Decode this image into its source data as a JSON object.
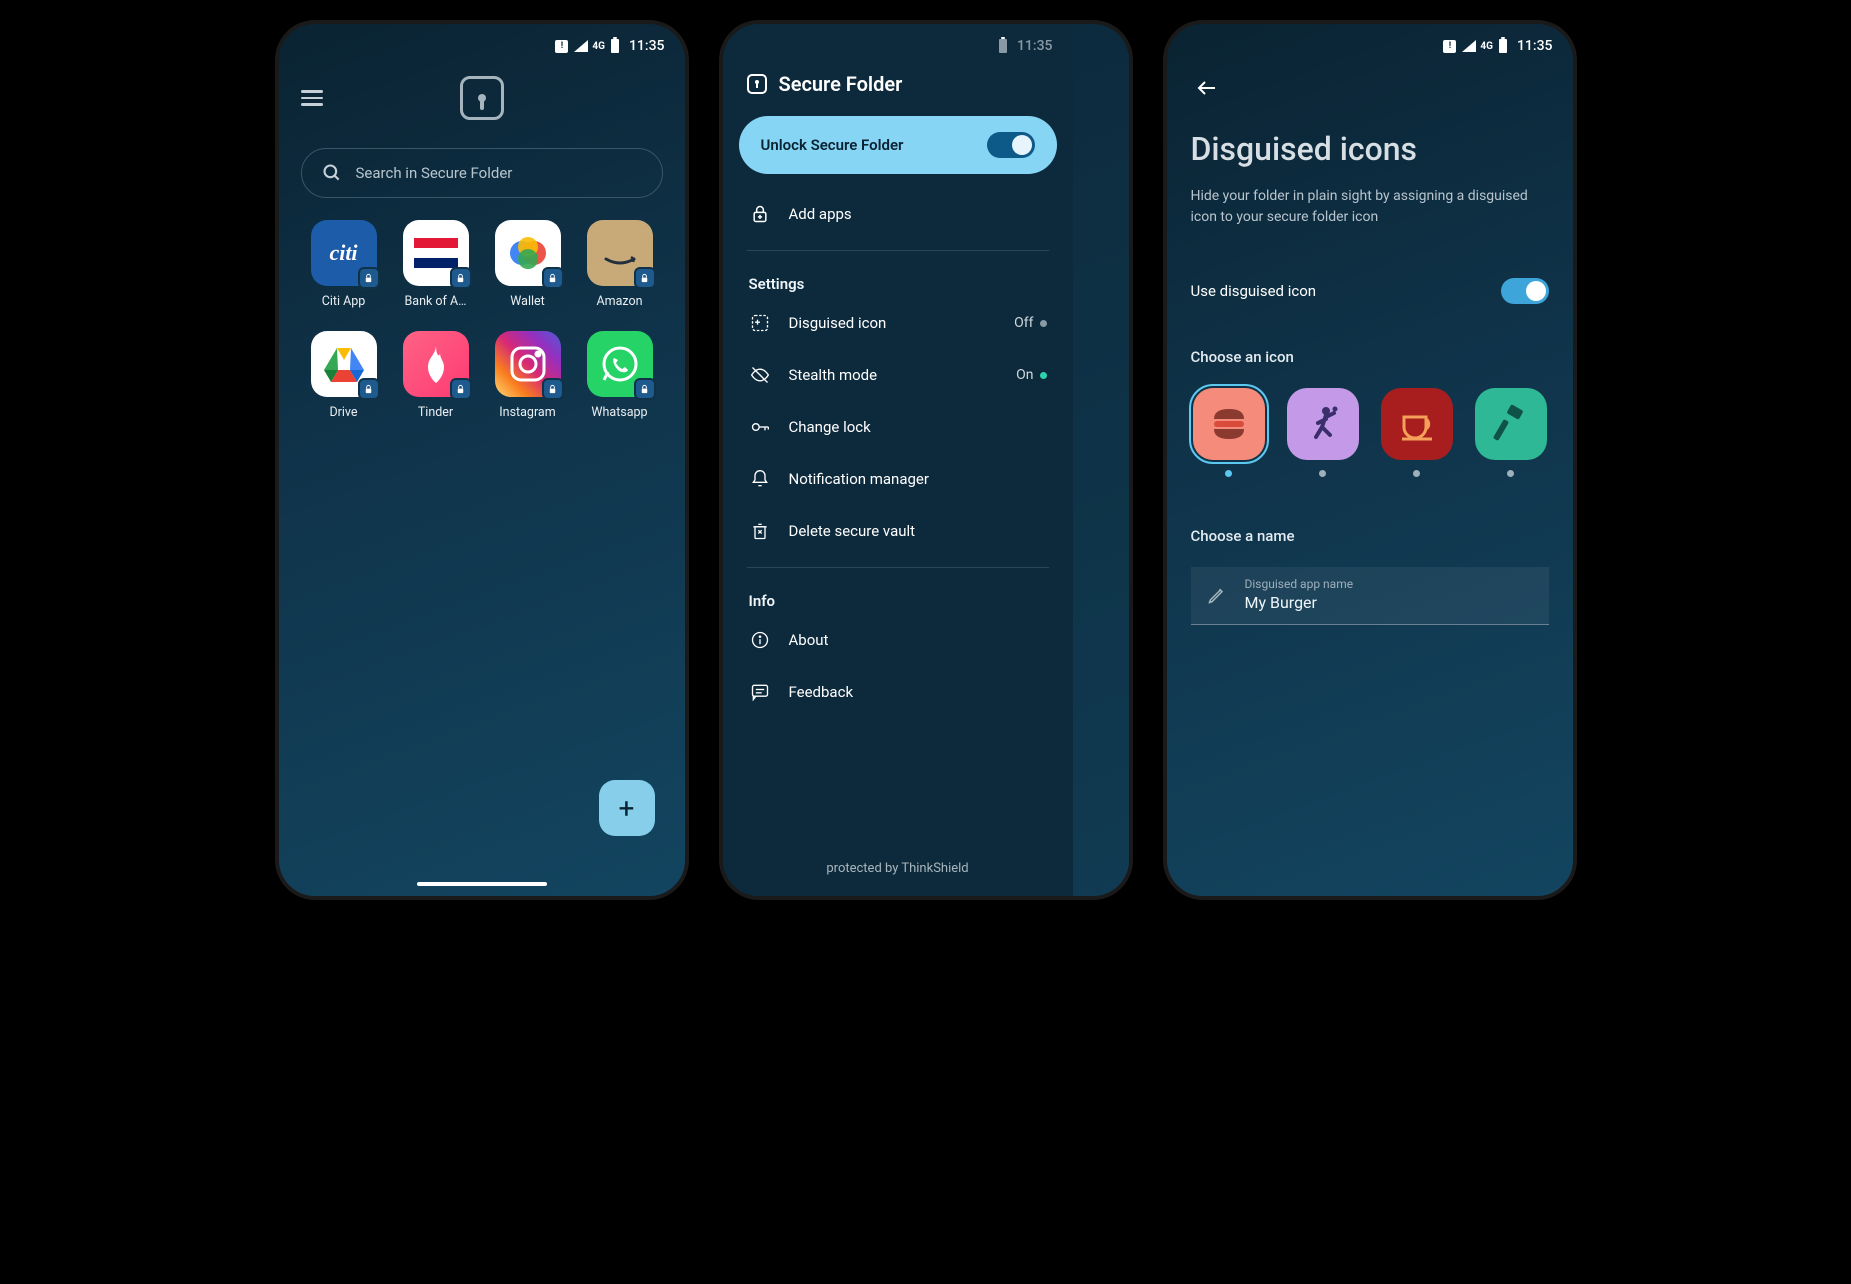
{
  "status": {
    "network": "4G",
    "time": "11:35"
  },
  "screen1": {
    "search_placeholder": "Search in Secure Folder",
    "apps": [
      {
        "label": "Citi App",
        "bg": "#1d5ca8",
        "txt": "citi",
        "txtcolor": "#fff"
      },
      {
        "label": "Bank of A…",
        "bg": "#ffffff",
        "txt": "",
        "flag": true
      },
      {
        "label": "Wallet",
        "bg": "#ffffff",
        "txt": "",
        "wallet": true
      },
      {
        "label": "Amazon",
        "bg": "#c8a978",
        "txt": "",
        "amazon": true
      },
      {
        "label": "Drive",
        "bg": "#ffffff",
        "txt": "",
        "drive": true
      },
      {
        "label": "Tinder",
        "bg": "linear-gradient(135deg,#ff6385,#fd3a73)",
        "txt": "",
        "tinder": true
      },
      {
        "label": "Instagram",
        "bg": "linear-gradient(45deg,#feda75,#fa7e1e,#d62976,#962fbf,#4f5bd5)",
        "txt": "",
        "insta": true
      },
      {
        "label": "Whatsapp",
        "bg": "#25d366",
        "txt": "",
        "whatsapp": true
      }
    ],
    "fab": "+"
  },
  "screen2": {
    "title": "Secure Folder",
    "unlock_label": "Unlock Secure Folder",
    "add_apps": "Add apps",
    "settings_label": "Settings",
    "settings": [
      {
        "label": "Disguised icon",
        "status": "Off",
        "dot": "off",
        "icon": "disguise"
      },
      {
        "label": "Stealth mode",
        "status": "On",
        "dot": "on",
        "icon": "stealth"
      },
      {
        "label": "Change lock",
        "status": "",
        "dot": "",
        "icon": "key"
      },
      {
        "label": "Notification manager",
        "status": "",
        "dot": "",
        "icon": "bell"
      },
      {
        "label": "Delete secure vault",
        "status": "",
        "dot": "",
        "icon": "trash"
      }
    ],
    "info_label": "Info",
    "info": [
      {
        "label": "About",
        "icon": "info"
      },
      {
        "label": "Feedback",
        "icon": "chat"
      }
    ],
    "footer": "protected by ThinkShield"
  },
  "screen3": {
    "title": "Disguised icons",
    "desc": "Hide your folder in plain sight by assigning a disguised icon to your secure folder icon",
    "toggle_label": "Use disguised icon",
    "choose_icon_label": "Choose an icon",
    "icons": [
      {
        "name": "burger",
        "bg": "#f58b7a",
        "selected": true
      },
      {
        "name": "dance",
        "bg": "#c49ae8",
        "selected": false
      },
      {
        "name": "coffee",
        "bg": "#a81e1e",
        "selected": false
      },
      {
        "name": "hammer",
        "bg": "#2fb896",
        "selected": false
      }
    ],
    "choose_name_label": "Choose a name",
    "name_field_label": "Disguised app name",
    "name_field_value": "My Burger"
  }
}
